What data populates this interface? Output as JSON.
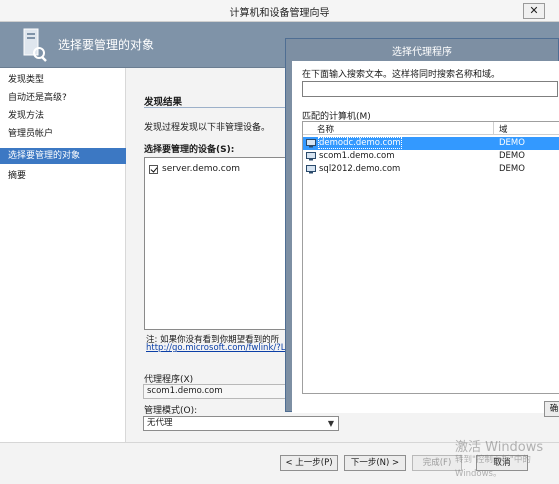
{
  "window": {
    "title": "计算机和设备管理向导",
    "close_glyph": "✕"
  },
  "header": {
    "title": "选择要管理的对象"
  },
  "nav": {
    "items": [
      {
        "label": "发现类型"
      },
      {
        "label": "自动还是高级?"
      },
      {
        "label": "发现方法"
      },
      {
        "label": "管理员帐户"
      },
      {
        "label": "选择要管理的对象"
      },
      {
        "label": "摘要"
      }
    ],
    "active_index": 4
  },
  "main": {
    "section_title": "发现结果",
    "intro": "发现过程发现以下非管理设备。",
    "devices_label": "选择要管理的设备(S):",
    "devices": [
      {
        "name": "server.demo.com",
        "checked": true
      }
    ],
    "note": "注: 如果你没有看到你期望看到的所",
    "note_link": "http://go.microsoft.com/fwlink/?Link",
    "proxy_label": "代理程序(X)",
    "proxy_value": "scom1.demo.com",
    "mode_label": "管理模式(O):",
    "mode_value": "无代理"
  },
  "buttons": {
    "prev": "< 上一步(P)",
    "next": "下一步(N) >",
    "finish": "完成(F)",
    "cancel": "取消"
  },
  "dialog": {
    "title": "选择代理程序",
    "prompt": "在下面输入搜索文本。这样将同时搜索名称和域。",
    "search_value": "",
    "match_label": "匹配的计算机(M)",
    "columns": {
      "name": "名称",
      "domain": "域"
    },
    "rows": [
      {
        "name": "demodc.demo.com",
        "domain": "DEMO",
        "selected": true
      },
      {
        "name": "scom1.demo.com",
        "domain": "DEMO",
        "selected": false
      },
      {
        "name": "sql2012.demo.com",
        "domain": "DEMO",
        "selected": false
      }
    ],
    "confirm_partial": "确"
  },
  "watermark": {
    "line1": "激活 Windows",
    "line2": "转到\"控制面板\"中的",
    "line3": "Windows。"
  },
  "colors": {
    "accent": "#3c78c3",
    "header_band": "#7f93a8",
    "selection": "#3399ff",
    "link": "#0b3fa7"
  }
}
